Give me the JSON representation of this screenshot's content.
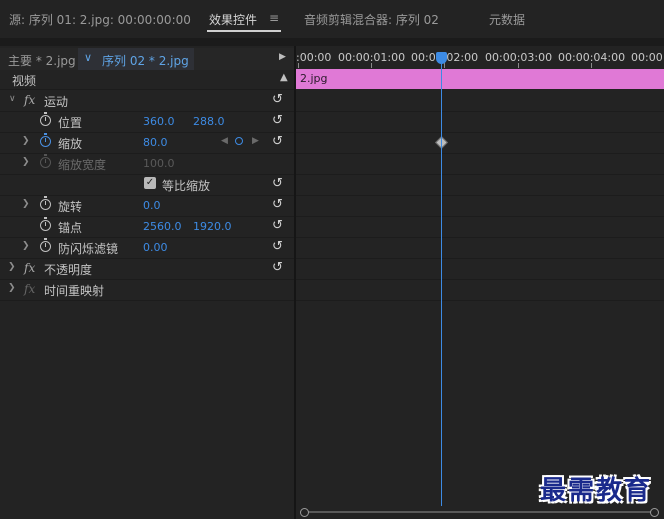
{
  "tabs": {
    "source": "源: 序列 01: 2.jpg: 00:00:00:00",
    "effect_controls": "效果控件",
    "menu_icon": "≡",
    "audio_mixer": "音频剪辑混合器: 序列 02",
    "metadata": "元数据"
  },
  "clip_header": {
    "master": "主要 * 2.jpg",
    "sequence": "序列 02 * 2.jpg"
  },
  "section": {
    "video": "视频"
  },
  "effects": {
    "motion": "运动",
    "position": {
      "label": "位置",
      "x": "360.0",
      "y": "288.0"
    },
    "scale": {
      "label": "缩放",
      "value": "80.0"
    },
    "scale_width": {
      "label": "缩放宽度",
      "value": "100.0"
    },
    "uniform_scale": {
      "label": "等比缩放",
      "checked": true
    },
    "rotation": {
      "label": "旋转",
      "value": "0.0"
    },
    "anchor": {
      "label": "锚点",
      "x": "2560.0",
      "y": "1920.0"
    },
    "anti_flicker": {
      "label": "防闪烁滤镜",
      "value": "0.00"
    },
    "opacity": "不透明度",
    "time_remap": "时间重映射",
    "fx": "fx"
  },
  "timeline": {
    "ticks": [
      ":00:00",
      "00:00:01:00",
      "00:00:02:00",
      "00:00:03:00",
      "00:00:04:00",
      "00:00"
    ],
    "clip_label": "2.jpg",
    "clip_color": "#e079d6",
    "playhead_color": "#3d8be4"
  },
  "watermark": "最需教育"
}
